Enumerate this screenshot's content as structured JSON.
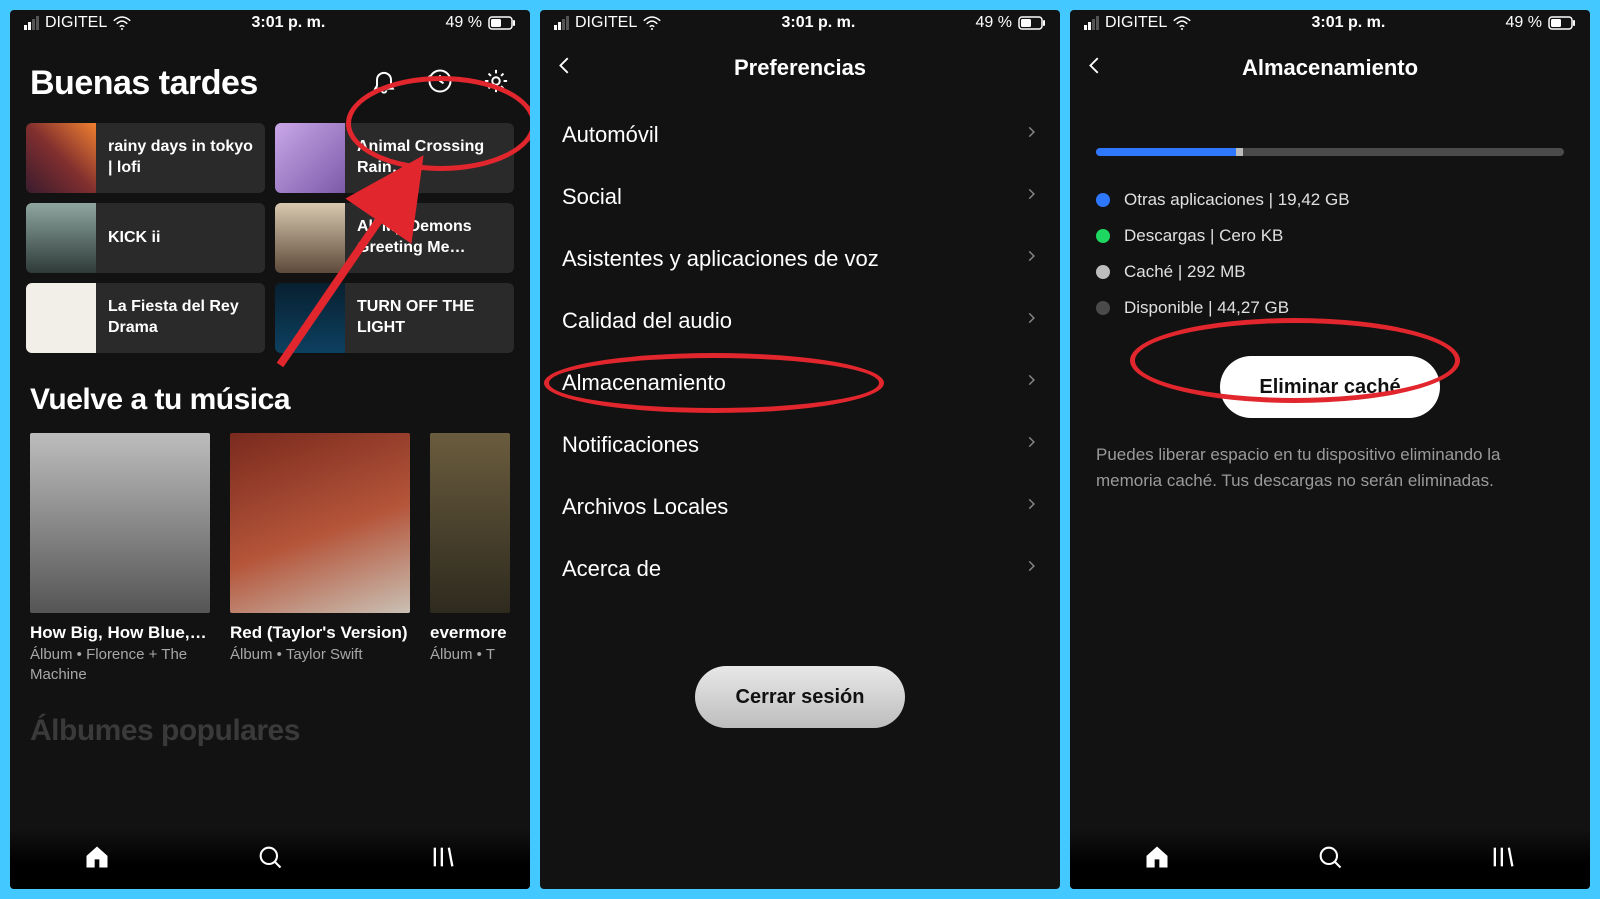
{
  "status": {
    "carrier": "DIGITEL",
    "time": "3:01 p. m.",
    "battery_text": "49 %"
  },
  "home": {
    "greeting": "Buenas tardes",
    "tiles": [
      {
        "label": "rainy days in tokyo | lofi"
      },
      {
        "label": "Animal Crossing Rain…"
      },
      {
        "label": "KICK ii"
      },
      {
        "label": "All My Demons Greeting Me…"
      },
      {
        "label": "La Fiesta del Rey Drama"
      },
      {
        "label": "TURN OFF THE LIGHT"
      }
    ],
    "back_to_music": "Vuelve a tu música",
    "cards": [
      {
        "title": "How Big, How Blue,…",
        "sub": "Álbum • Florence + The Machine"
      },
      {
        "title": "Red (Taylor's Version)",
        "sub": "Álbum • Taylor Swift"
      },
      {
        "title": "evermore",
        "sub": "Álbum • T"
      }
    ],
    "popular_albums": "Álbumes populares"
  },
  "prefs": {
    "title": "Preferencias",
    "items": [
      "Automóvil",
      "Social",
      "Asistentes y aplicaciones de voz",
      "Calidad del audio",
      "Almacenamiento",
      "Notificaciones",
      "Archivos Locales",
      "Acerca de"
    ],
    "logout": "Cerrar sesión"
  },
  "storage": {
    "title": "Almacenamiento",
    "bar_fill_pct": 30,
    "legend": [
      {
        "color": "#2e77ff",
        "label": "Otras aplicaciones | 19,42 GB"
      },
      {
        "color": "#1ed760",
        "label": "Descargas | Cero KB"
      },
      {
        "color": "#bdbdbd",
        "label": "Caché | 292 MB"
      },
      {
        "color": "#4a4a4a",
        "label": "Disponible | 44,27 GB"
      }
    ],
    "clear_btn": "Eliminar caché",
    "hint": "Puedes liberar espacio en tu dispositivo eliminando la memoria caché. Tus descargas no serán eliminadas."
  }
}
